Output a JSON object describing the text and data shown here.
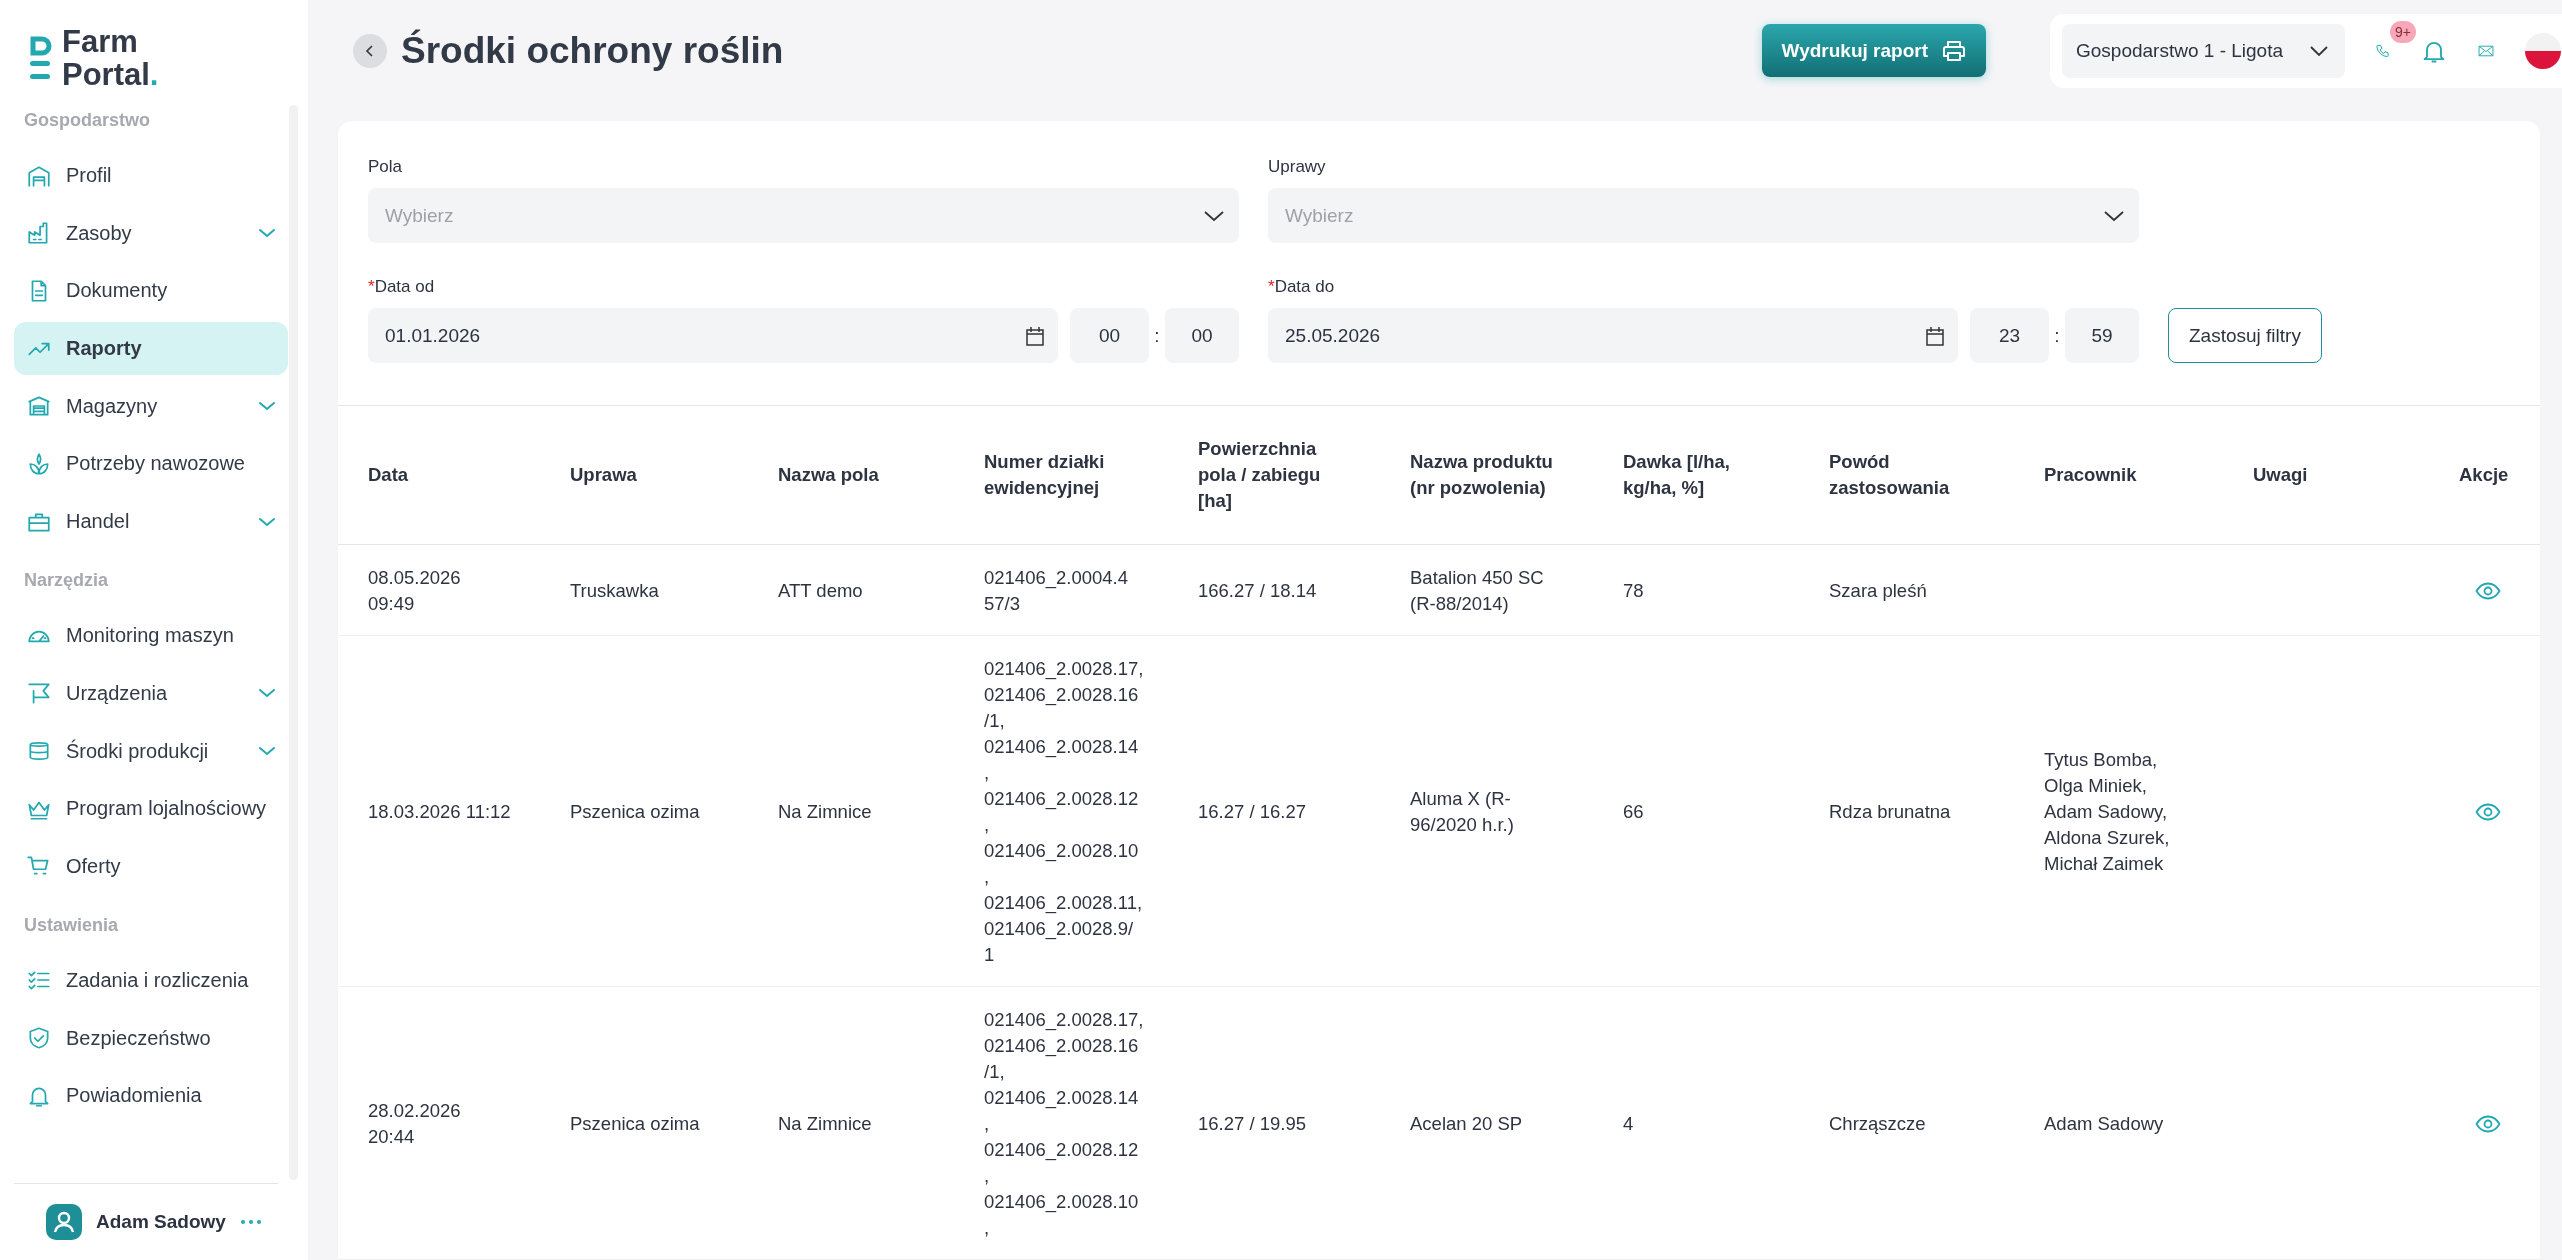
{
  "logo": {
    "top": "Farm",
    "bottom": "Portal",
    "dot": "."
  },
  "sidebar": {
    "sections": [
      {
        "title": "Gospodarstwo",
        "items": [
          {
            "label": "Profil",
            "expandable": false,
            "selected": false
          },
          {
            "label": "Zasoby",
            "expandable": true,
            "selected": false
          },
          {
            "label": "Dokumenty",
            "expandable": false,
            "selected": false
          },
          {
            "label": "Raporty",
            "expandable": false,
            "selected": true
          },
          {
            "label": "Magazyny",
            "expandable": true,
            "selected": false
          },
          {
            "label": "Potrzeby nawozowe",
            "expandable": false,
            "selected": false
          },
          {
            "label": "Handel",
            "expandable": true,
            "selected": false
          }
        ]
      },
      {
        "title": "Narzędzia",
        "items": [
          {
            "label": "Monitoring maszyn",
            "expandable": false,
            "selected": false
          },
          {
            "label": "Urządzenia",
            "expandable": true,
            "selected": false
          },
          {
            "label": "Środki produkcji",
            "expandable": true,
            "selected": false
          },
          {
            "label": "Program lojalnościowy",
            "expandable": false,
            "selected": false
          },
          {
            "label": "Oferty",
            "expandable": false,
            "selected": false
          }
        ]
      },
      {
        "title": "Ustawienia",
        "items": [
          {
            "label": "Zadania i rozliczenia",
            "expandable": false,
            "selected": false
          },
          {
            "label": "Bezpieczeństwo",
            "expandable": false,
            "selected": false
          },
          {
            "label": "Powiadomienia",
            "expandable": false,
            "selected": false
          }
        ]
      }
    ],
    "user": {
      "name": "Adam Sadowy"
    }
  },
  "header": {
    "title": "Środki ochrony roślin",
    "print_button": "Wydrukuj raport",
    "farm_select": "Gospodarstwo 1 - Ligota",
    "notification_badge": "9+"
  },
  "filters": {
    "selects": [
      {
        "label": "Pola",
        "placeholder": "Wybierz"
      },
      {
        "label": "Uprawy",
        "placeholder": "Wybierz"
      }
    ],
    "dates": [
      {
        "label": "Data od",
        "required": true,
        "value": "01.01.2026",
        "hour": "00",
        "minute": "00",
        "separator": ":"
      },
      {
        "label": "Data do",
        "required": true,
        "value": "25.05.2026",
        "hour": "23",
        "minute": "59",
        "separator": ":"
      }
    ],
    "required_mark": "*",
    "apply_button": "Zastosuj filtry"
  },
  "table": {
    "columns": [
      "Data",
      "Uprawa",
      "Nazwa pola",
      "Numer działki\newidencyjnej",
      "Powierzchnia\npola / zabiegu\n[ha]",
      "Nazwa produktu\n(nr pozwolenia)",
      "Dawka [l/ha,\nkg/ha, %]",
      "Powód\nzastosowania",
      "Pracownik",
      "Uwagi",
      "Akcje"
    ],
    "rows": [
      {
        "date": "08.05.2026\n09:49",
        "crop": "Truskawka",
        "field_name": "ATT demo",
        "parcel_number": "021406_2.0004.4\n57/3",
        "area": "166.27 / 18.14",
        "product": "Batalion 450 SC\n(R-88/2014)",
        "dose": "78",
        "reason": "Szara pleśń"
      },
      {
        "date": "18.03.2026 11:12",
        "crop": "Pszenica ozima",
        "field_name": "Na Zimnice",
        "parcel_number": "021406_2.0028.17,\n021406_2.0028.16\n/1,\n021406_2.0028.14\n,\n021406_2.0028.12\n,\n021406_2.0028.10\n,\n021406_2.0028.11,\n021406_2.0028.9/\n1",
        "area": "16.27 / 16.27",
        "product": "Aluma X (R-\n96/2020 h.r.)",
        "dose": "66",
        "reason": "Rdza brunatna",
        "worker": "Tytus Bomba,\nOlga Miniek,\nAdam Sadowy,\nAldona Szurek,\nMichał Zaimek"
      },
      {
        "date": "28.02.2026\n20:44",
        "crop": "Pszenica ozima",
        "field_name": "Na Zimnice",
        "parcel_number": "021406_2.0028.17,\n021406_2.0028.16\n/1,\n021406_2.0028.14\n,\n021406_2.0028.12\n,\n021406_2.0028.10\n,",
        "area": "16.27 / 19.95",
        "product": "Acelan 20 SP",
        "dose": "4",
        "reason": "Chrząszcze",
        "worker": "Adam Sadowy"
      }
    ]
  }
}
